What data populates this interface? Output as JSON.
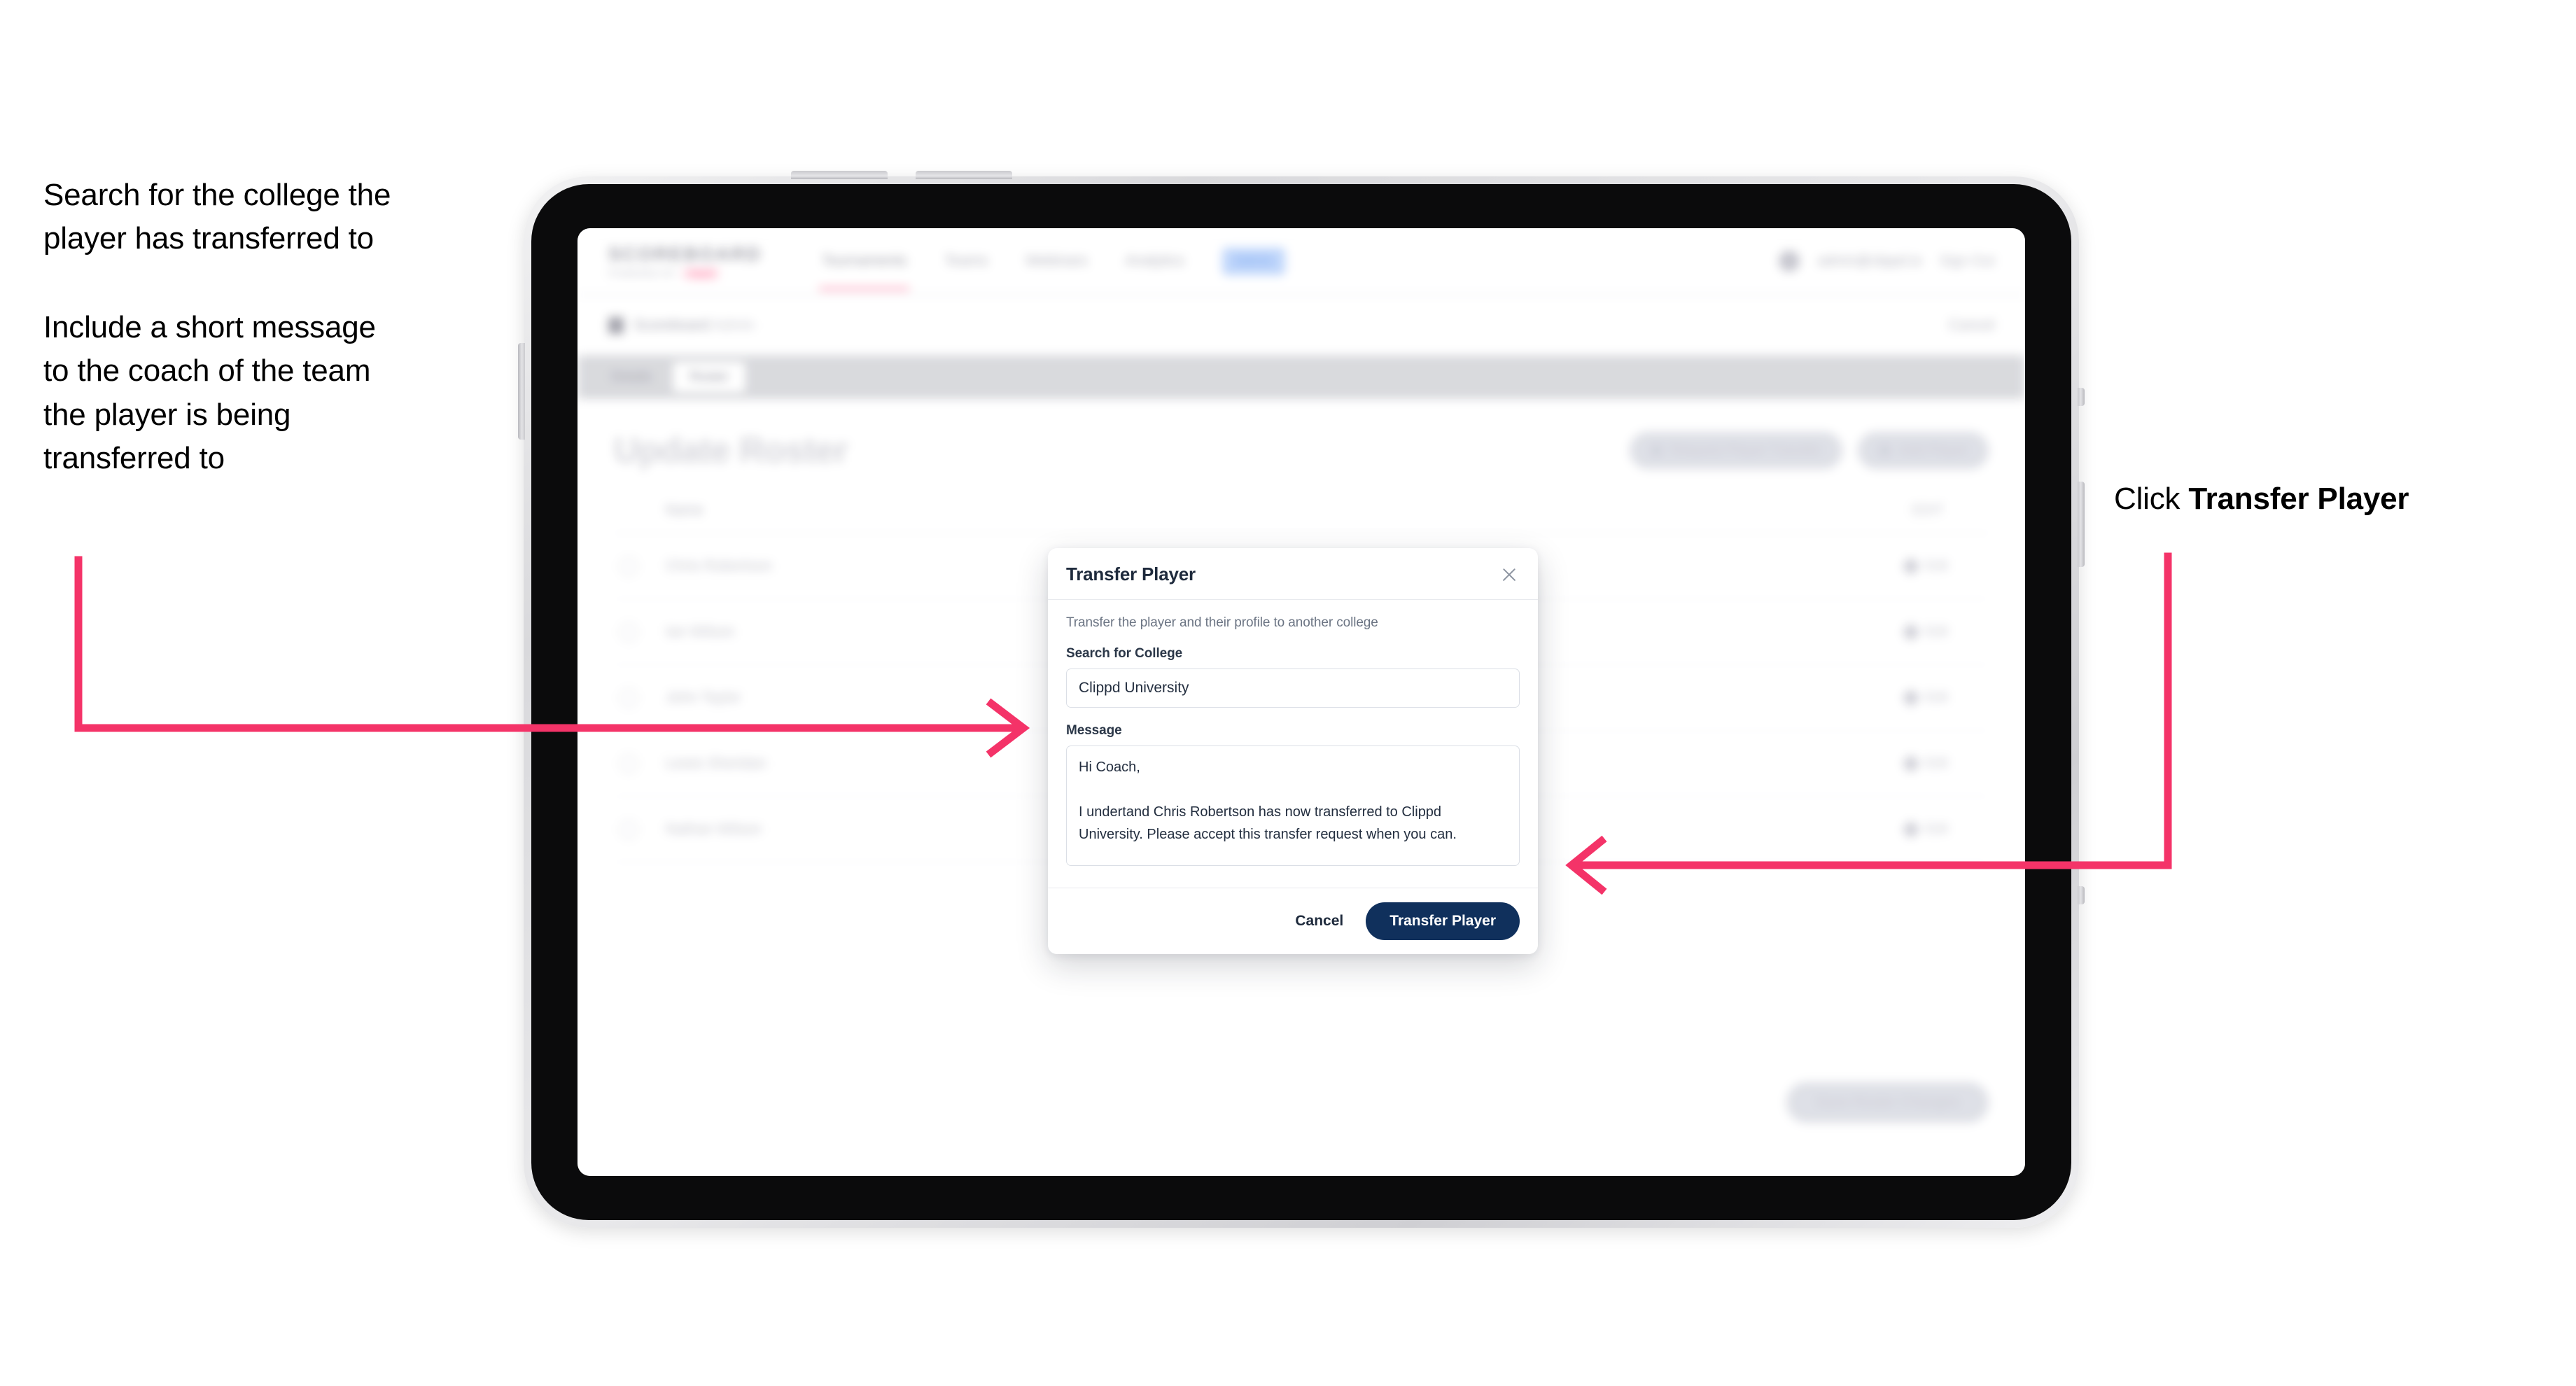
{
  "annotations": {
    "left_line_1": "Search for the college the",
    "left_line_2": "player has transferred to",
    "left_line_3": "Include a short message",
    "left_line_4": "to the coach of the team",
    "left_line_5": "the player is being",
    "left_line_6": "transferred to",
    "right_prefix": "Click ",
    "right_bold": "Transfer Player",
    "arrow_color": "#F43368"
  },
  "app": {
    "nav": {
      "brand": "SCOREBOARD",
      "brand_sub": "POWERED BY",
      "brand_pill": "clippd",
      "links": [
        {
          "label": "Tournaments",
          "active": true
        },
        {
          "label": "Teams",
          "active": false
        },
        {
          "label": "Webinars",
          "active": false
        },
        {
          "label": "Analytics",
          "active": false
        }
      ],
      "pill": "Admin",
      "user": "admin@clippd.io",
      "sign_out": "Sign Out"
    },
    "breadcrumb": {
      "icon": "building-icon",
      "text": "Scoreboard",
      "muted": "Admin",
      "right": "Cancel"
    },
    "tabs": [
      {
        "label": "Details",
        "active": false
      },
      {
        "label": "Roster",
        "active": true
      }
    ],
    "page": {
      "title": "Update Roster",
      "actions": [
        {
          "icon": "refresh-icon",
          "label": "Request Player Transfer"
        },
        {
          "icon": "plus-icon",
          "label": "Add Player"
        }
      ],
      "table": {
        "header_name": "Name",
        "header_action": "EDIT",
        "rows": [
          {
            "name": "Chris Robertson",
            "edit": "Edit"
          },
          {
            "name": "Ian Wilson",
            "edit": "Edit"
          },
          {
            "name": "John Taylor",
            "edit": "Edit"
          },
          {
            "name": "Lewis Sheridan",
            "edit": "Edit"
          },
          {
            "name": "Nathan Wilson",
            "edit": "Edit"
          }
        ]
      },
      "bottom_cta": "Save Roster Changes"
    }
  },
  "modal": {
    "title": "Transfer Player",
    "close_icon": "close-icon",
    "description": "Transfer the player and their profile to another college",
    "college_label": "Search for College",
    "college_value": "Clippd University",
    "college_placeholder": "Search for College",
    "message_label": "Message",
    "message_value": "Hi Coach,\n\nI undertand Chris Robertson has now transferred to Clippd University. Please accept this transfer request when you can.",
    "message_placeholder": "Message",
    "cancel_label": "Cancel",
    "submit_label": "Transfer Player",
    "submit_color": "#10305C"
  }
}
